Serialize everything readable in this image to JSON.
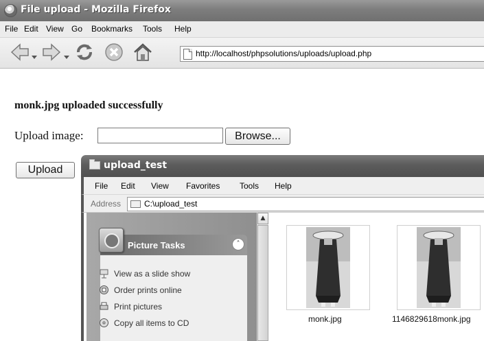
{
  "firefox": {
    "title": "File upload - Mozilla Firefox",
    "menu": [
      "File",
      "Edit",
      "View",
      "Go",
      "Bookmarks",
      "Tools",
      "Help"
    ],
    "url": "http://localhost/phpsolutions/uploads/upload.php"
  },
  "page": {
    "message": "monk.jpg uploaded successfully",
    "upload_label": "Upload image:",
    "file_value": "",
    "browse_label": "Browse...",
    "upload_button": "Upload"
  },
  "explorer": {
    "title": "upload_test",
    "menu": [
      "File",
      "Edit",
      "View",
      "Favorites",
      "Tools",
      "Help"
    ],
    "address_label": "Address",
    "address_value": "C:\\upload_test",
    "tasks": {
      "header": "Picture Tasks",
      "items": [
        "View as a slide show",
        "Order prints online",
        "Print pictures",
        "Copy all items to CD"
      ]
    },
    "files": [
      {
        "name": "monk.jpg",
        "icon": "monk-photo-thumbnail"
      },
      {
        "name": "1146829618monk.jpg",
        "icon": "monk-photo-thumbnail"
      }
    ]
  },
  "icons": {
    "back": "back-arrow-icon",
    "forward": "forward-arrow-icon",
    "reload": "reload-icon",
    "stop": "stop-icon",
    "home": "home-icon",
    "page": "page-icon",
    "folder": "folder-icon"
  },
  "colors": {
    "title_bar": "#7d7d7d",
    "explorer_title_bar": "#5c5c5c",
    "tasks_pane": "#9a9a9a"
  }
}
